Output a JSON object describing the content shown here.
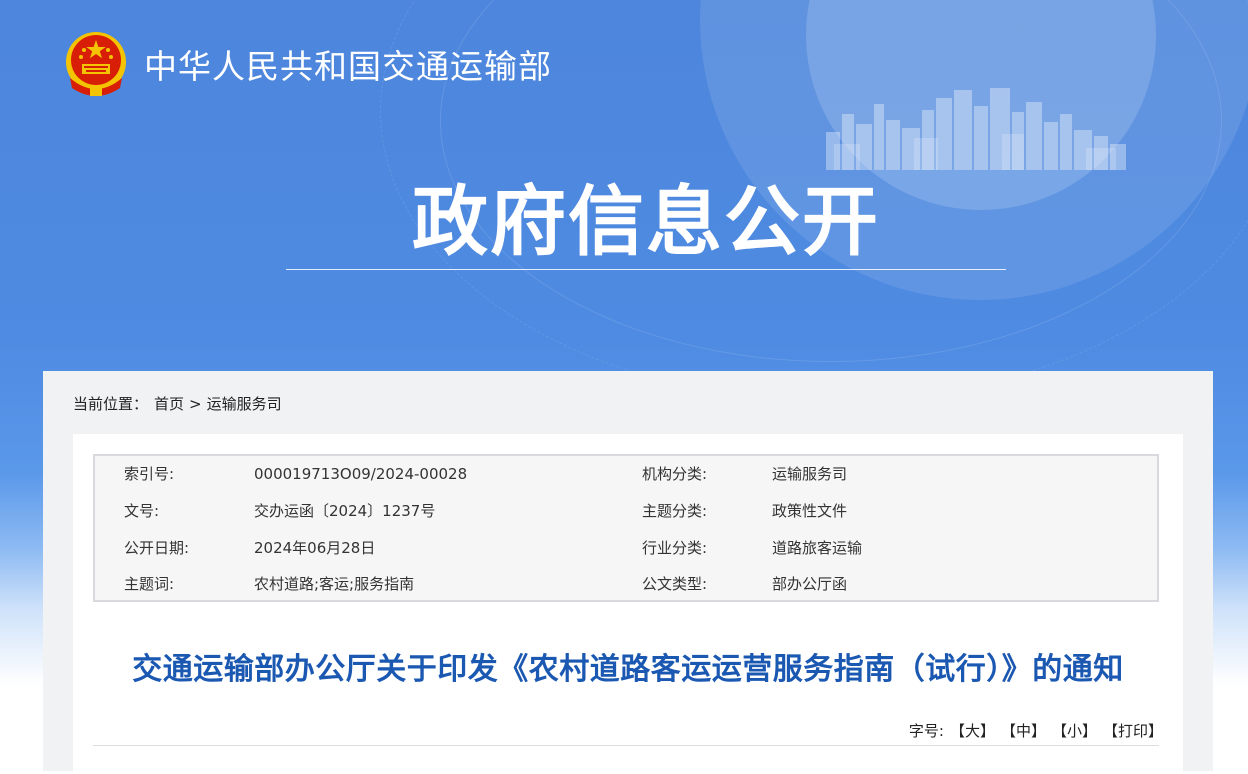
{
  "header": {
    "site_name": "中华人民共和国交通运输部",
    "banner_title": "政府信息公开",
    "emblem_icon": "national-emblem-icon"
  },
  "breadcrumb": {
    "label": "当前位置：",
    "items": [
      "首页",
      "运输服务司"
    ],
    "separator": ">"
  },
  "meta": {
    "rows": [
      {
        "k1": "索引号:",
        "v1": "000019713O09/2024-00028",
        "k2": "机构分类:",
        "v2": "运输服务司"
      },
      {
        "k1": "文号:",
        "v1": "交办运函〔2024〕1237号",
        "k2": "主题分类:",
        "v2": "政策性文件"
      },
      {
        "k1": "公开日期:",
        "v1": "2024年06月28日",
        "k2": "行业分类:",
        "v2": "道路旅客运输"
      },
      {
        "k1": "主题词:",
        "v1": "农村道路;客运;服务指南",
        "k2": "公文类型:",
        "v2": "部办公厅函"
      }
    ]
  },
  "document": {
    "title": "交通运输部办公厅关于印发《农村道路客运运营服务指南（试行）》的通知"
  },
  "font_size": {
    "label": "字号:",
    "large": "【大】",
    "medium": "【中】",
    "small": "【小】",
    "print": "【打印】"
  },
  "colors": {
    "banner_blue": "#4f8be2",
    "title_blue": "#1b58b2",
    "emblem_red": "#d81e06",
    "emblem_gold": "#f5c400"
  }
}
